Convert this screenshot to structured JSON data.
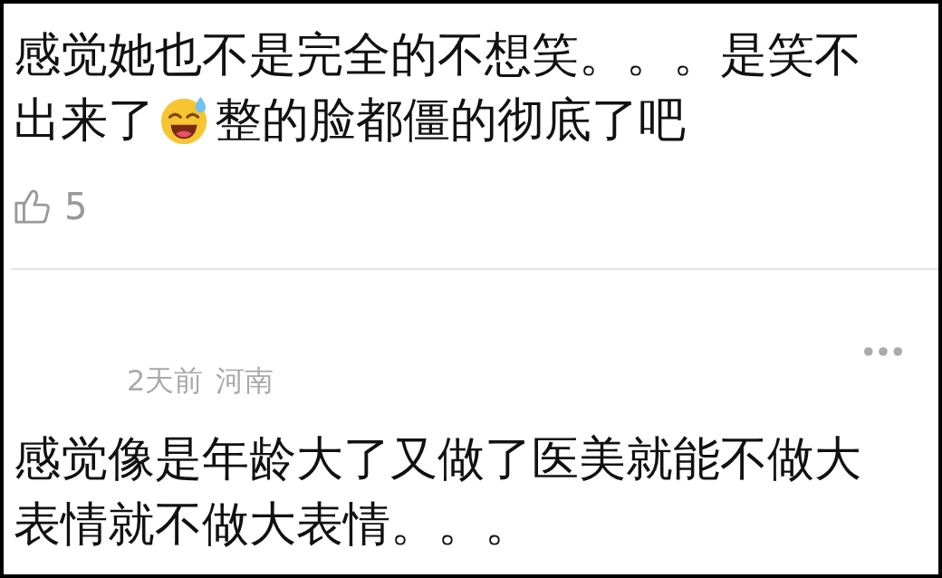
{
  "comments": [
    {
      "line_1": "感觉她也不是完全的不想笑。。。是笑不",
      "line_2_before": "出来了",
      "line_2_after": "整的脸都僵的彻底了吧",
      "likes": "5"
    },
    {
      "time": "2天前",
      "location": "河南",
      "text": "感觉像是年龄大了又做了医美就能不做大表情就不做大表情。。。"
    }
  ]
}
